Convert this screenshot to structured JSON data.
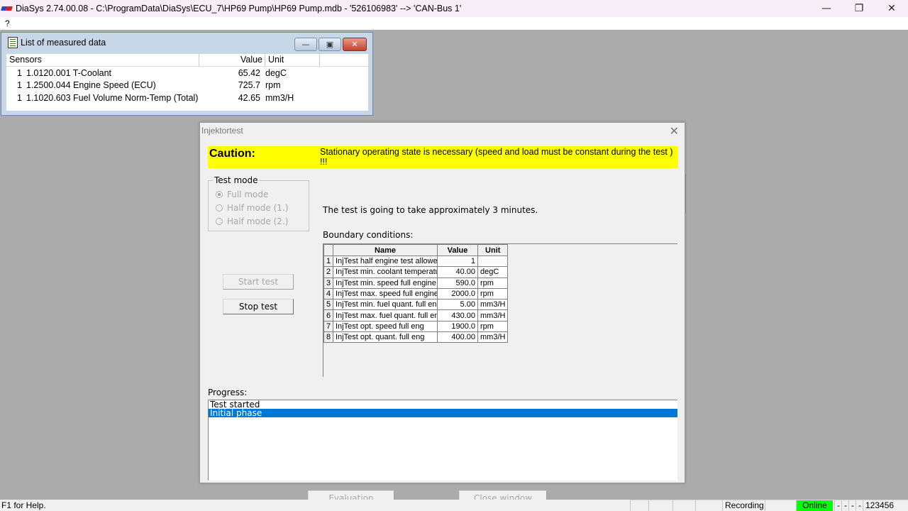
{
  "app": {
    "title": "DiaSys 2.74.00.08 - C:\\ProgramData\\DiaSys\\ECU_7\\HP69 Pump\\HP69 Pump.mdb - '526106983' --> 'CAN-Bus 1'",
    "window_controls": {
      "minimize": "—",
      "restore": "❐",
      "close": "✕"
    }
  },
  "menu": {
    "items": [
      "?"
    ]
  },
  "measured_window": {
    "title": "List of measured data",
    "controls": {
      "minimize": "—",
      "maximize": "▣",
      "close": "✕"
    },
    "columns": [
      "Sensors",
      "Value",
      "Unit"
    ],
    "rows": [
      {
        "num": "1",
        "sensor": "1.0120.001 T-Coolant",
        "value": "65.42",
        "unit": "degC"
      },
      {
        "num": "1",
        "sensor": "1.2500.044 Engine Speed (ECU)",
        "value": "725.7",
        "unit": "rpm"
      },
      {
        "num": "1",
        "sensor": "1.1020.603 Fuel Volume Norm-Temp (Total)",
        "value": "42.65",
        "unit": "mm3/H"
      }
    ]
  },
  "dialog": {
    "title": "Injektortest",
    "close": "✕",
    "caution": {
      "label": "Caution:",
      "message": "Stationary operating state is necessary (speed and load must be constant during the test ) !!!",
      "color": "#ffff00"
    },
    "test_mode": {
      "title": "Test mode",
      "options": [
        {
          "label": "Full mode",
          "selected": true
        },
        {
          "label": "Half mode (1.)",
          "selected": false
        },
        {
          "label": "Half mode (2.)",
          "selected": false
        }
      ]
    },
    "buttons": {
      "start": "Start test",
      "stop": "Stop test",
      "evaluation": "Evaluation",
      "close_window": "Close window"
    },
    "info": "The test is going to take approximately 3 minutes.",
    "boundary_label": "Boundary conditions:",
    "boundary_table": {
      "columns": [
        "",
        "Name",
        "Value",
        "Unit"
      ],
      "rows": [
        {
          "idx": "1",
          "name": "InjTest half engine test allowed",
          "value": "1",
          "unit": ""
        },
        {
          "idx": "2",
          "name": "InjTest min. coolant temperature",
          "value": "40.00",
          "unit": "degC"
        },
        {
          "idx": "3",
          "name": "InjTest min. speed full engine",
          "value": "590.0",
          "unit": "rpm"
        },
        {
          "idx": "4",
          "name": "InjTest max. speed full engine",
          "value": "2000.0",
          "unit": "rpm"
        },
        {
          "idx": "5",
          "name": "InjTest min. fuel quant. full eng",
          "value": "5.00",
          "unit": "mm3/H"
        },
        {
          "idx": "6",
          "name": "InjTest max. fuel quant. full eng",
          "value": "430.00",
          "unit": "mm3/H"
        },
        {
          "idx": "7",
          "name": "InjTest opt. speed full eng",
          "value": "1900.0",
          "unit": "rpm"
        },
        {
          "idx": "8",
          "name": "InjTest opt. quant. full eng",
          "value": "400.00",
          "unit": "mm3/H"
        }
      ]
    },
    "progress_label": "Progress:",
    "progress_items": [
      {
        "text": "Test started",
        "selected": false
      },
      {
        "text": "Initial phase",
        "selected": true
      }
    ]
  },
  "statusbar": {
    "help": "F1 for Help.",
    "recording": "Recording",
    "online": "Online",
    "online_color": "#00ff00",
    "flags": [
      "-",
      "-",
      "-",
      "-"
    ],
    "code": "123456"
  }
}
